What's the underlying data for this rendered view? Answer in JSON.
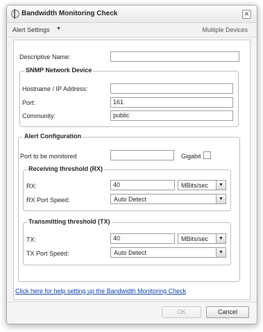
{
  "window": {
    "title": "Bandwidth Monitoring Check",
    "close_label": "✕"
  },
  "toolbar": {
    "alert_settings_label": "Alert Settings",
    "alert_settings_arrow": "▼",
    "multiple_devices_label": "Multiple Devices"
  },
  "form": {
    "descriptive_name": {
      "label": "Descriptive Name:",
      "value": ""
    },
    "snmp_group": {
      "title": "SNMP Network Device",
      "hostname": {
        "label": "Hostname / IP Address:",
        "value": ""
      },
      "port": {
        "label": "Port:",
        "value": "161"
      },
      "community": {
        "label": "Community:",
        "value": "public"
      }
    },
    "alert_group": {
      "title": "Alert Configuration",
      "port_monitored": {
        "label": "Port to be monitored",
        "value": ""
      },
      "gigabit": {
        "label": "Gigabit",
        "checked": false
      },
      "rx_group": {
        "title": "Receiving threshold (RX)",
        "rx": {
          "label": "RX:",
          "value": "40",
          "unit": "MBits/sec"
        },
        "rx_speed": {
          "label": "RX Port Speed:",
          "value": "Auto Detect"
        }
      },
      "tx_group": {
        "title": "Transmitting threshold (TX)",
        "tx": {
          "label": "TX:",
          "value": "40",
          "unit": "MBits/sec"
        },
        "tx_speed": {
          "label": "TX Port Speed:",
          "value": "Auto Detect"
        }
      }
    },
    "help_link": "Click here for help setting up the Bandwidth Monitoring Check"
  },
  "footer": {
    "ok_label": "OK",
    "ok_enabled": false,
    "cancel_label": "Cancel"
  },
  "icons": {
    "dropdown": "chevron-down-icon",
    "close": "close-icon"
  },
  "colors": {
    "link": "#0b3fa8",
    "window_bg": "#f5f5f5",
    "disabled_text": "#a8a8a8"
  }
}
